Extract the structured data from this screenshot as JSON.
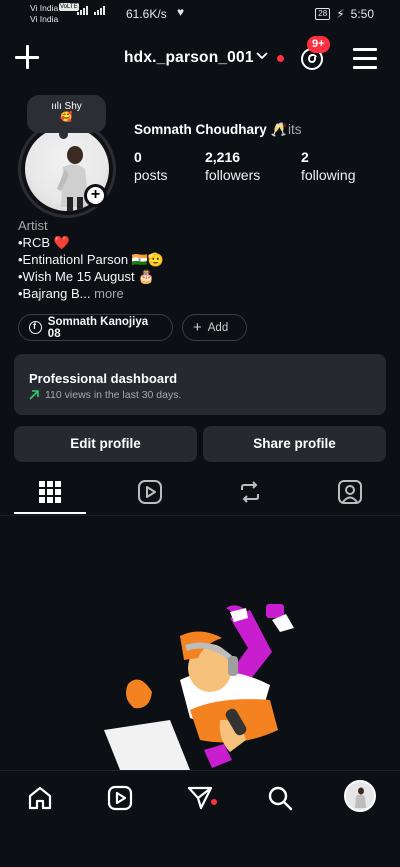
{
  "status_bar": {
    "carrier_1": "Vi India",
    "carrier_badge": "VoLTE",
    "carrier_2": "Vi India",
    "speed": "61.6K/s",
    "battery": "28",
    "time": "5:50"
  },
  "header": {
    "username": "hdx._parson_001",
    "notification_count": "9+"
  },
  "profile": {
    "note_icon": "audio-waves-icon",
    "note_text": "Shy",
    "note_emoji": "🥰",
    "display_name": "Somnath Choudhary 🥂",
    "display_name_suffix": "its",
    "stats": [
      {
        "value": "0",
        "label": "posts"
      },
      {
        "value": "2,216",
        "label": "followers"
      },
      {
        "value": "2",
        "label": "following"
      }
    ],
    "category": "Artist",
    "bio_lines": [
      "•RCB ❤️",
      "•Entinationl Parson 🇮🇳🫡",
      "•Wish Me 15 August 🎂",
      "•Bajrang B..."
    ],
    "more_label": "more",
    "facebook_chip": "Somnath Kanojiya 08",
    "add_chip": "Add"
  },
  "dashboard": {
    "title": "Professional dashboard",
    "subtitle": "110 views in the last 30 days.",
    "trend_color": "#2ecc71"
  },
  "actions": {
    "edit_profile": "Edit profile",
    "share_profile": "Share profile"
  },
  "tabs": [
    "grid-icon",
    "reels-icon",
    "reposts-icon",
    "tagged-icon"
  ],
  "bottom_nav": [
    "home-icon",
    "reels-icon",
    "direct-messages-icon",
    "search-icon",
    "profile-avatar"
  ],
  "colors": {
    "background": "#0c0f14",
    "card": "#262930",
    "accent_red": "#ff3040"
  }
}
